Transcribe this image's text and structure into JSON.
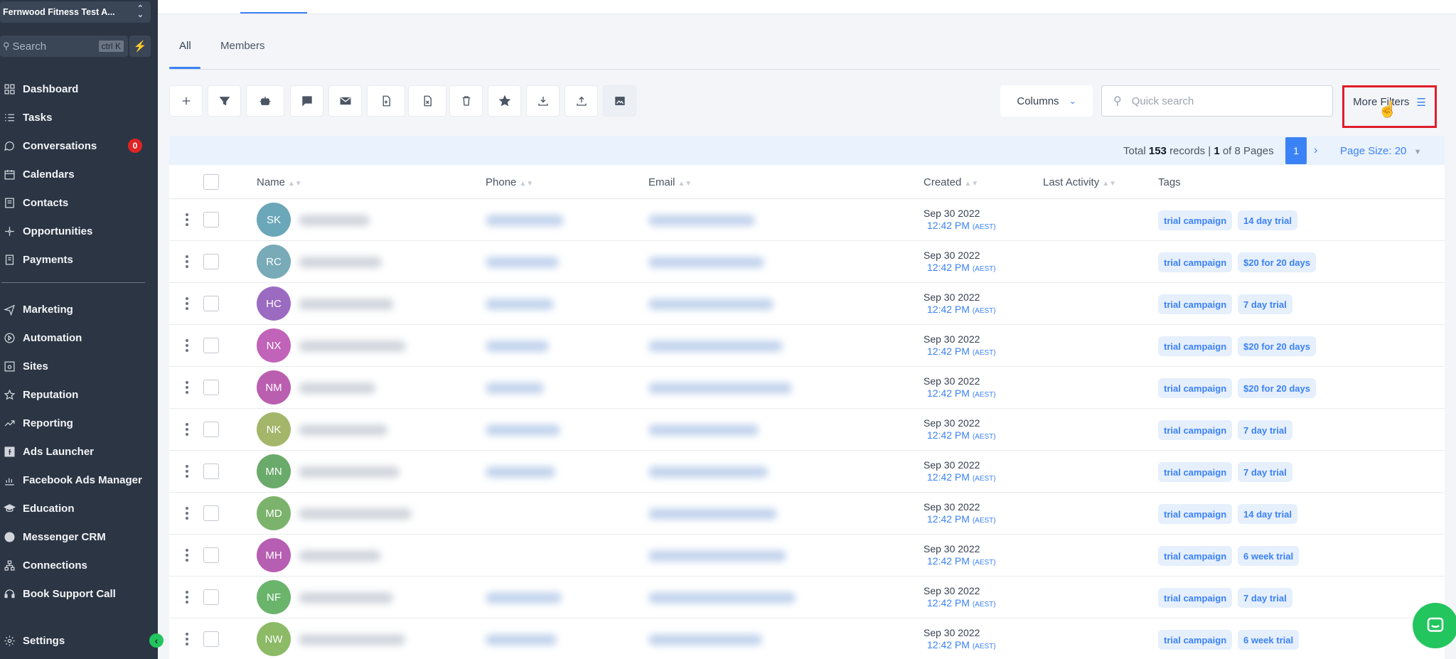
{
  "sidebar": {
    "account": "Fernwood Fitness Test A...",
    "search_label": "Search",
    "search_shortcut": "ctrl K",
    "items": [
      {
        "label": "Dashboard",
        "icon": "dashboard-icon"
      },
      {
        "label": "Tasks",
        "icon": "tasks-icon"
      },
      {
        "label": "Conversations",
        "icon": "chat-bubble-icon",
        "badge": "0"
      },
      {
        "label": "Calendars",
        "icon": "calendar-icon"
      },
      {
        "label": "Contacts",
        "icon": "contacts-icon"
      },
      {
        "label": "Opportunities",
        "icon": "opportunities-icon"
      },
      {
        "label": "Payments",
        "icon": "payments-icon"
      },
      {
        "label": "Marketing",
        "icon": "send-icon"
      },
      {
        "label": "Automation",
        "icon": "automation-icon"
      },
      {
        "label": "Sites",
        "icon": "sites-icon"
      },
      {
        "label": "Reputation",
        "icon": "star-icon"
      },
      {
        "label": "Reporting",
        "icon": "trend-icon"
      },
      {
        "label": "Ads Launcher",
        "icon": "facebook-icon"
      },
      {
        "label": "Facebook Ads Manager",
        "icon": "bar-chart-icon"
      },
      {
        "label": "Education",
        "icon": "graduation-cap-icon"
      },
      {
        "label": "Messenger CRM",
        "icon": "messenger-icon"
      },
      {
        "label": "Connections",
        "icon": "network-icon"
      },
      {
        "label": "Book Support Call",
        "icon": "headset-icon"
      }
    ],
    "settings": "Settings"
  },
  "tabs": [
    "All",
    "Members"
  ],
  "toolbar": {
    "columns": "Columns",
    "search_placeholder": "Quick search",
    "more_filters": "More Filters"
  },
  "pagination": {
    "total_prefix": "Total",
    "total": "153",
    "records_text": "records |",
    "page": "1",
    "of_pages": "of 8 Pages",
    "current": "1",
    "page_size": "Page Size: 20"
  },
  "table": {
    "headers": {
      "name": "Name",
      "phone": "Phone",
      "email": "Email",
      "created": "Created",
      "last_activity": "Last Activity",
      "tags": "Tags"
    },
    "rows": [
      {
        "initials": "SK",
        "color": "#6aa7b8",
        "date": "Sep 30 2022",
        "time": "12:42 PM",
        "tz": "(AEST)",
        "tags": [
          "trial campaign",
          "14 day trial"
        ],
        "has_phone": true
      },
      {
        "initials": "RC",
        "color": "#78aab8",
        "date": "Sep 30 2022",
        "time": "12:42 PM",
        "tz": "(AEST)",
        "tags": [
          "trial campaign",
          "$20 for 20 days"
        ],
        "has_phone": true
      },
      {
        "initials": "HC",
        "color": "#9b6bc2",
        "date": "Sep 30 2022",
        "time": "12:42 PM",
        "tz": "(AEST)",
        "tags": [
          "trial campaign",
          "7 day trial"
        ],
        "has_phone": true
      },
      {
        "initials": "NX",
        "color": "#c163b8",
        "date": "Sep 30 2022",
        "time": "12:42 PM",
        "tz": "(AEST)",
        "tags": [
          "trial campaign",
          "$20 for 20 days"
        ],
        "has_phone": true
      },
      {
        "initials": "NM",
        "color": "#ba5fb0",
        "date": "Sep 30 2022",
        "time": "12:42 PM",
        "tz": "(AEST)",
        "tags": [
          "trial campaign",
          "$20 for 20 days"
        ],
        "has_phone": true
      },
      {
        "initials": "NK",
        "color": "#a3b66a",
        "date": "Sep 30 2022",
        "time": "12:42 PM",
        "tz": "(AEST)",
        "tags": [
          "trial campaign",
          "7 day trial"
        ],
        "has_phone": true
      },
      {
        "initials": "MN",
        "color": "#6aaa6a",
        "date": "Sep 30 2022",
        "time": "12:42 PM",
        "tz": "(AEST)",
        "tags": [
          "trial campaign",
          "7 day trial"
        ],
        "has_phone": true
      },
      {
        "initials": "MD",
        "color": "#7cb36c",
        "date": "Sep 30 2022",
        "time": "12:42 PM",
        "tz": "(AEST)",
        "tags": [
          "trial campaign",
          "14 day trial"
        ],
        "has_phone": false
      },
      {
        "initials": "MH",
        "color": "#b65eb2",
        "date": "Sep 30 2022",
        "time": "12:42 PM",
        "tz": "(AEST)",
        "tags": [
          "trial campaign",
          "6 week trial"
        ],
        "has_phone": false
      },
      {
        "initials": "NF",
        "color": "#6ab46c",
        "date": "Sep 30 2022",
        "time": "12:42 PM",
        "tz": "(AEST)",
        "tags": [
          "trial campaign",
          "7 day trial"
        ],
        "has_phone": true
      },
      {
        "initials": "NW",
        "color": "#8cba66",
        "date": "Sep 30 2022",
        "time": "12:42 PM",
        "tz": "(AEST)",
        "tags": [
          "trial campaign",
          "6 week trial"
        ],
        "has_phone": true
      }
    ]
  }
}
